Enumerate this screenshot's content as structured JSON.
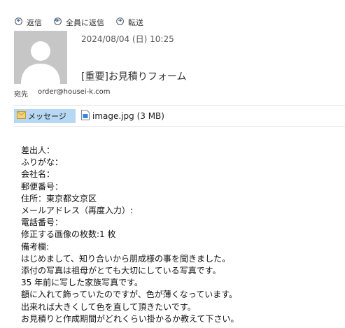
{
  "toolbar": {
    "reply_label": "返信",
    "reply_all_label": "全員に返信",
    "forward_label": "転送"
  },
  "header": {
    "datetime": "2024/08/04 (日) 10:25",
    "subject": "[重要]お見積りフォーム",
    "to_label": "宛先",
    "to_address": "order@housei-k.com"
  },
  "attachments": {
    "message_label": "メッセージ",
    "file_label": "image.jpg (3 MB)"
  },
  "body_lines": [
    "差出人：",
    "ふりがな：",
    "会社名：",
    "郵便番号：",
    "住所：東京都文京区",
    "メールアドレス（再度入力）:",
    "電話番号：",
    "修正する画像の枚数:1 枚",
    "備考欄:",
    "はじめまして、知り合いから朋成様の事を聞きました。",
    "添付の写真は祖母がとても大切にしている写真です。",
    "35 年前に写した家族写真です。",
    "額に入れて飾っていたのですが、色が薄くなっています。",
    "出来れば大きくして色を直して頂きたいです。",
    "お見積りと作成期間がどれくらい掛かるか教えて下さい。"
  ],
  "icons": {
    "reply": "reply-icon",
    "reply_all": "reply-all-icon",
    "forward": "forward-icon",
    "avatar": "person-silhouette",
    "message": "envelope-icon",
    "file": "image-file-icon"
  },
  "colors": {
    "icon_blue": "#2b6cb0",
    "message_tab_bg": "#b7d8f2",
    "avatar_bg": "#c6c6c6"
  }
}
